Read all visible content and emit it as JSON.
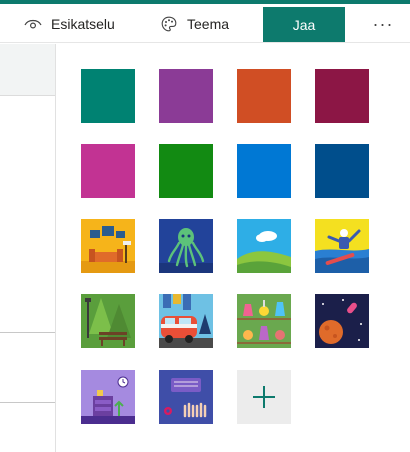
{
  "toolbar": {
    "preview_label": "Esikatselu",
    "theme_label": "Teema",
    "share_label": "Jaa",
    "more_label": "···"
  },
  "colors": {
    "accent": "#0d7a6d"
  },
  "theme_panel": {
    "color_swatches": [
      "#008272",
      "#8b3b96",
      "#d04e24",
      "#8c1645",
      "#c23393",
      "#128a12",
      "#0078d4",
      "#004e8c"
    ],
    "image_themes": [
      "living-room",
      "octopus",
      "sky-hills",
      "snowboarder",
      "forest-bench",
      "van-city",
      "chemistry-lab",
      "space-rocket",
      "purple-room",
      "keyboard-desk"
    ],
    "add_icon": "plus-icon"
  }
}
